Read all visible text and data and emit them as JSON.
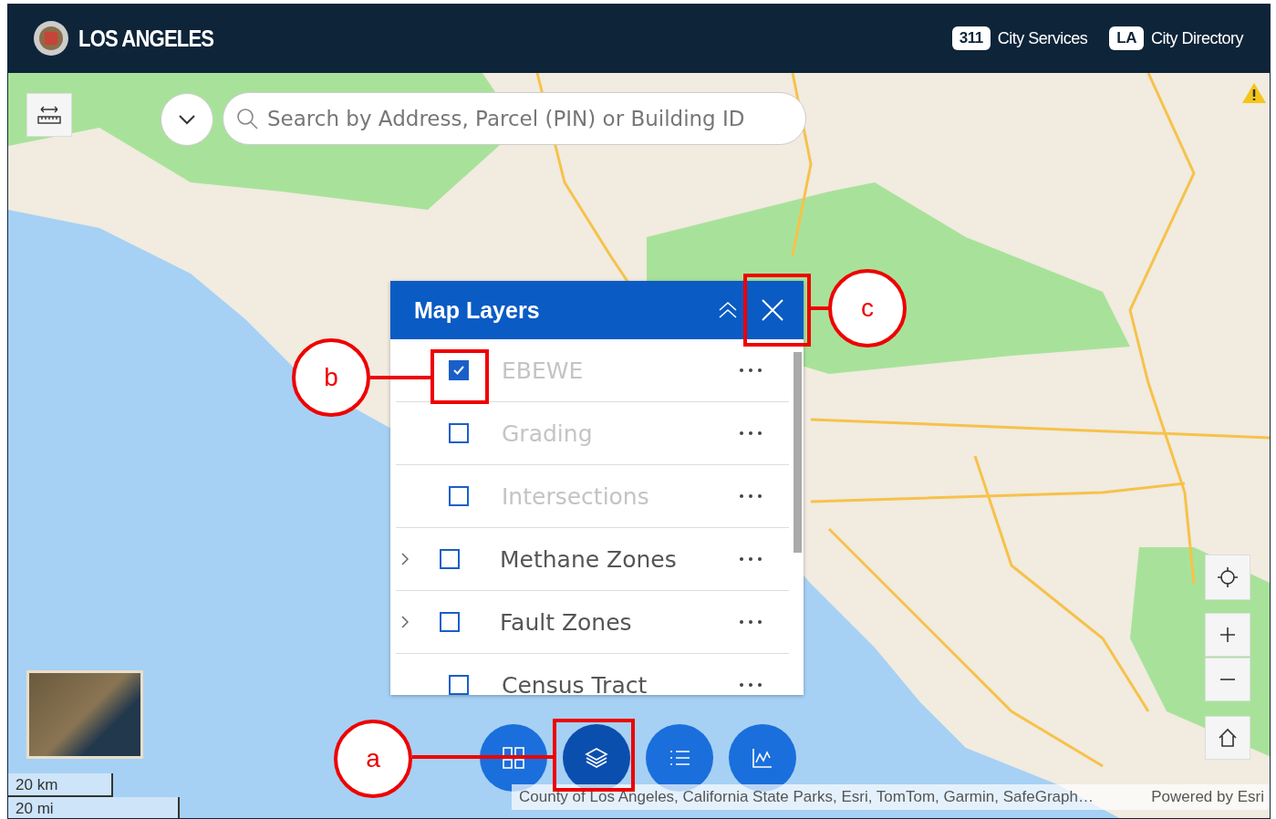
{
  "header": {
    "title": "LOS ANGELES",
    "links": [
      {
        "badge": "311",
        "label": "City Services"
      },
      {
        "badge": "LA",
        "label": "City Directory"
      }
    ]
  },
  "search": {
    "placeholder": "Search by Address, Parcel (PIN) or Building ID"
  },
  "layers_panel": {
    "title": "Map Layers",
    "layers": [
      {
        "name": "EBEWE",
        "checked": true,
        "disabled": true,
        "expandable": false
      },
      {
        "name": "Grading",
        "checked": false,
        "disabled": true,
        "expandable": false
      },
      {
        "name": "Intersections",
        "checked": false,
        "disabled": true,
        "expandable": false
      },
      {
        "name": "Methane Zones",
        "checked": false,
        "disabled": false,
        "expandable": true
      },
      {
        "name": "Fault Zones",
        "checked": false,
        "disabled": false,
        "expandable": true
      },
      {
        "name": "Census Tract",
        "checked": false,
        "disabled": false,
        "expandable": false
      }
    ]
  },
  "toolbar": [
    {
      "kind": "grid",
      "selected": false
    },
    {
      "kind": "layers",
      "selected": true
    },
    {
      "kind": "list",
      "selected": false
    },
    {
      "kind": "chart",
      "selected": false
    }
  ],
  "scale_bar": [
    "20 km",
    "20 mi"
  ],
  "attribution": "County of Los Angeles, California State Parks, Esri, TomTom, Garmin, SafeGraph…",
  "powered_by": "Powered by Esri",
  "annotations": [
    {
      "label": "a"
    },
    {
      "label": "b"
    },
    {
      "label": "c"
    }
  ]
}
